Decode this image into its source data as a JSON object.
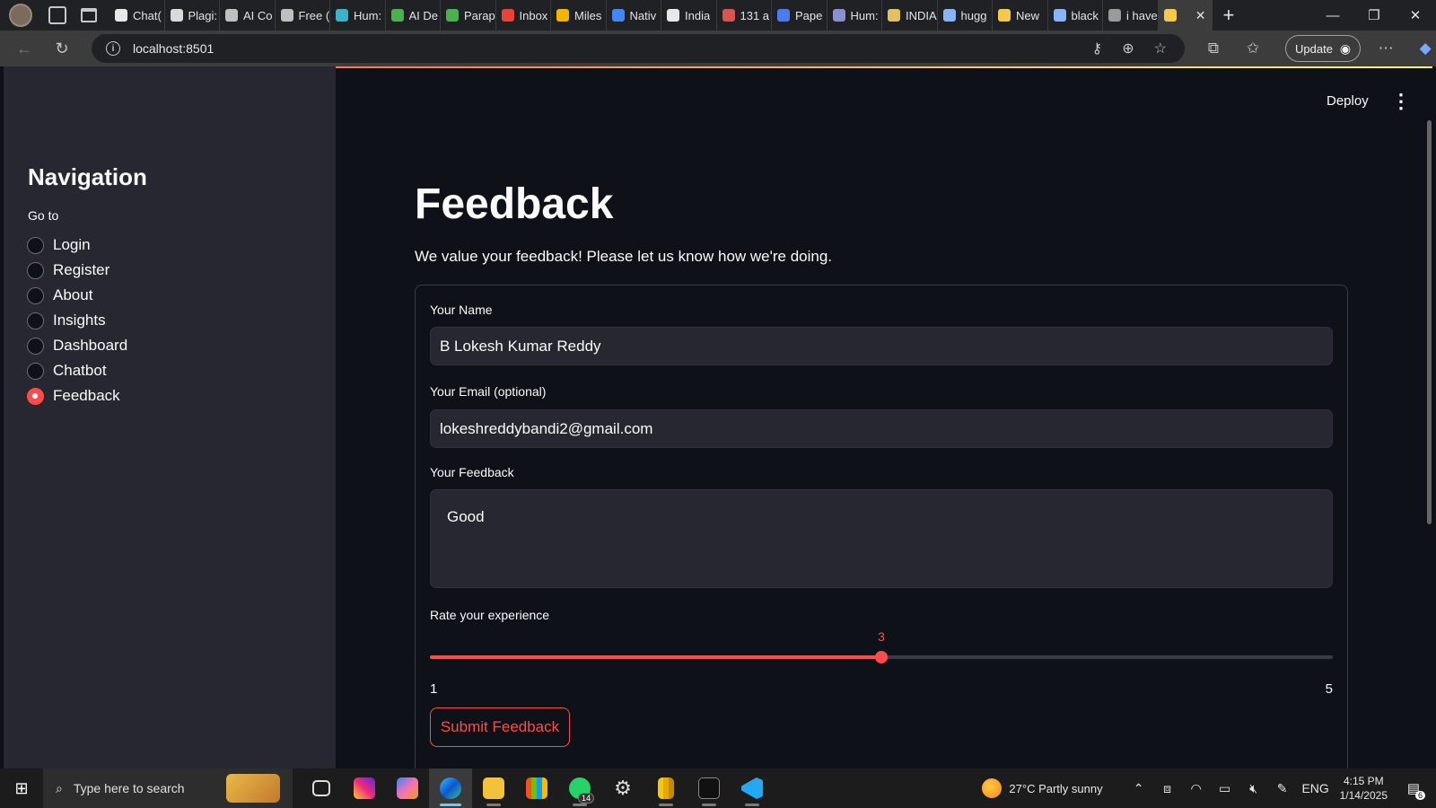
{
  "browser": {
    "tabs": [
      {
        "title": "Chat(",
        "color": "#e8e8e8"
      },
      {
        "title": "Plagi:",
        "color": "#d9d9d9"
      },
      {
        "title": "AI Co",
        "color": "#bfbfbf"
      },
      {
        "title": "Free (",
        "color": "#bfbfbf"
      },
      {
        "title": "Hum:",
        "color": "#3cb4c8"
      },
      {
        "title": "AI De",
        "color": "#4caf50"
      },
      {
        "title": "Parap",
        "color": "#4caf50"
      },
      {
        "title": "Inbox",
        "color": "#ea4335"
      },
      {
        "title": "Miles",
        "color": "#f4b400"
      },
      {
        "title": "Nativ",
        "color": "#4285f4"
      },
      {
        "title": "India",
        "color": "#e8e8e8"
      },
      {
        "title": "131 a",
        "color": "#d9534f"
      },
      {
        "title": "Pape",
        "color": "#4a7cf0"
      },
      {
        "title": "Hum:",
        "color": "#8a8fd0"
      },
      {
        "title": "INDIA",
        "color": "#e0c060"
      },
      {
        "title": "hugg",
        "color": "#8ab4f8"
      },
      {
        "title": "New",
        "color": "#f2c94c"
      },
      {
        "title": "black",
        "color": "#8ab4f8"
      },
      {
        "title": "i have",
        "color": "#9a9a9a"
      }
    ],
    "active_tab_close": "✕",
    "new_tab": "+",
    "window_controls": [
      "—",
      "❐",
      "✕"
    ],
    "url": "localhost:8501",
    "update_label": "Update"
  },
  "app": {
    "deploy_label": "Deploy",
    "menu_icon": "⋮",
    "sidebar": {
      "title": "Navigation",
      "goto_label": "Go to",
      "options": [
        {
          "label": "Login",
          "selected": false
        },
        {
          "label": "Register",
          "selected": false
        },
        {
          "label": "About",
          "selected": false
        },
        {
          "label": "Insights",
          "selected": false
        },
        {
          "label": "Dashboard",
          "selected": false
        },
        {
          "label": "Chatbot",
          "selected": false
        },
        {
          "label": "Feedback",
          "selected": true
        }
      ]
    },
    "page": {
      "title": "Feedback",
      "subtitle": "We value your feedback! Please let us know how we're doing."
    },
    "form": {
      "name_label": "Your Name",
      "name_value": "B Lokesh Kumar Reddy",
      "email_label": "Your Email (optional)",
      "email_value": "lokeshreddybandi2@gmail.com",
      "feedback_label": "Your Feedback",
      "feedback_value": "Good",
      "rating_label": "Rate your experience",
      "rating_min": 1,
      "rating_max": 5,
      "rating_value": 3,
      "rating_min_label": "1",
      "rating_max_label": "5",
      "rating_value_label": "3",
      "submit_label": "Submit Feedback"
    },
    "accent_color": "#ff4b4b"
  },
  "taskbar": {
    "search_placeholder": "Type here to search",
    "whatsapp_badge": "14",
    "weather": "27°C  Partly sunny",
    "language": "ENG",
    "time": "4:15 PM",
    "date": "1/14/2025",
    "notification_count": "6"
  }
}
